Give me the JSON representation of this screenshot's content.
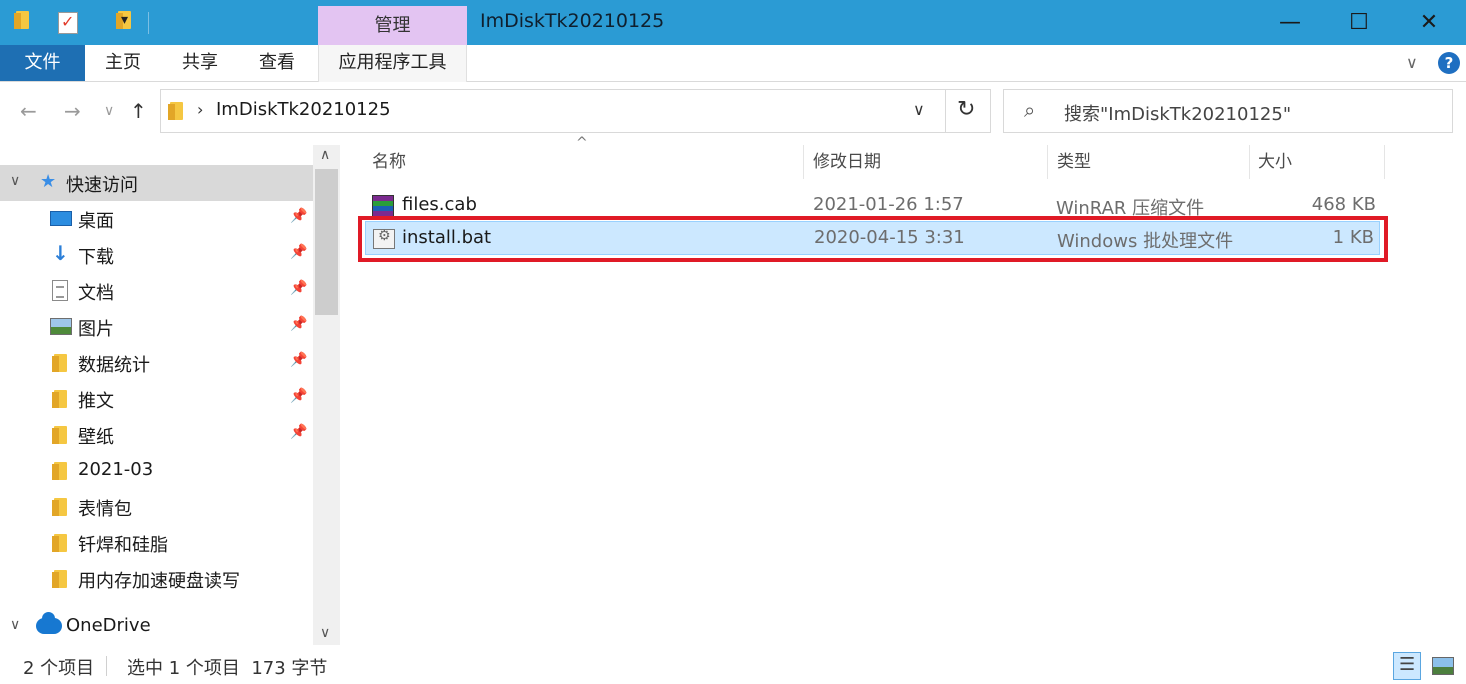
{
  "titlebar": {
    "manage_tab": "管理",
    "title": "ImDiskTk20210125",
    "minimize": "—",
    "maximize": "☐",
    "close": "✕",
    "qa_dropdown": "▾"
  },
  "ribbon": {
    "tabs": [
      "文件",
      "主页",
      "共享",
      "查看",
      "应用程序工具"
    ],
    "collapse": "∨",
    "help": "?"
  },
  "address": {
    "back": "←",
    "forward": "→",
    "recent": "∨",
    "up": "↑",
    "chevron": "›",
    "path": "ImDiskTk20210125",
    "dropdown": "∨",
    "refresh": "↻"
  },
  "search": {
    "icon": "⌕",
    "placeholder": "搜索\"ImDiskTk20210125\""
  },
  "nav": {
    "quick_access": "快速访问",
    "items": [
      {
        "label": "桌面",
        "icon": "desktop-icon",
        "pinned": true
      },
      {
        "label": "下载",
        "icon": "download-icon",
        "pinned": true
      },
      {
        "label": "文档",
        "icon": "document-icon",
        "pinned": true
      },
      {
        "label": "图片",
        "icon": "picture-icon",
        "pinned": true
      },
      {
        "label": "数据统计",
        "icon": "folder-icon",
        "pinned": true
      },
      {
        "label": "推文",
        "icon": "folder-icon",
        "pinned": true
      },
      {
        "label": "壁纸",
        "icon": "folder-icon",
        "pinned": true
      },
      {
        "label": "2021-03",
        "icon": "folder-icon",
        "pinned": false
      },
      {
        "label": "表情包",
        "icon": "folder-icon",
        "pinned": false
      },
      {
        "label": "钎焊和硅脂",
        "icon": "folder-icon",
        "pinned": false
      },
      {
        "label": "用内存加速硬盘读写",
        "icon": "folder-icon",
        "pinned": false
      }
    ],
    "onedrive": "OneDrive",
    "pin_glyph": "📌",
    "expander_open": "∨",
    "expander_closed": "∨",
    "scroll_up": "∧",
    "scroll_down": "∨"
  },
  "columns": {
    "name": "名称",
    "modified": "修改日期",
    "type": "类型",
    "size": "大小",
    "sort_caret": "^"
  },
  "files": [
    {
      "name": "files.cab",
      "modified": "2021-01-26 1:57",
      "type": "WinRAR 压缩文件",
      "size": "468 KB",
      "icon": "winrar-archive-icon",
      "selected": false
    },
    {
      "name": "install.bat",
      "modified": "2020-04-15 3:31",
      "type": "Windows 批处理文件",
      "size": "1 KB",
      "icon": "batch-file-icon",
      "selected": true
    }
  ],
  "status": {
    "count": "2 个项目",
    "selection": "选中 1 个项目  173 字节"
  },
  "colors": {
    "titlebar": "#2b9bd4",
    "manage_tab": "#e3c4f2",
    "file_tab": "#1e6fb3",
    "selection": "#cce8ff",
    "highlight": "#e01a26"
  }
}
